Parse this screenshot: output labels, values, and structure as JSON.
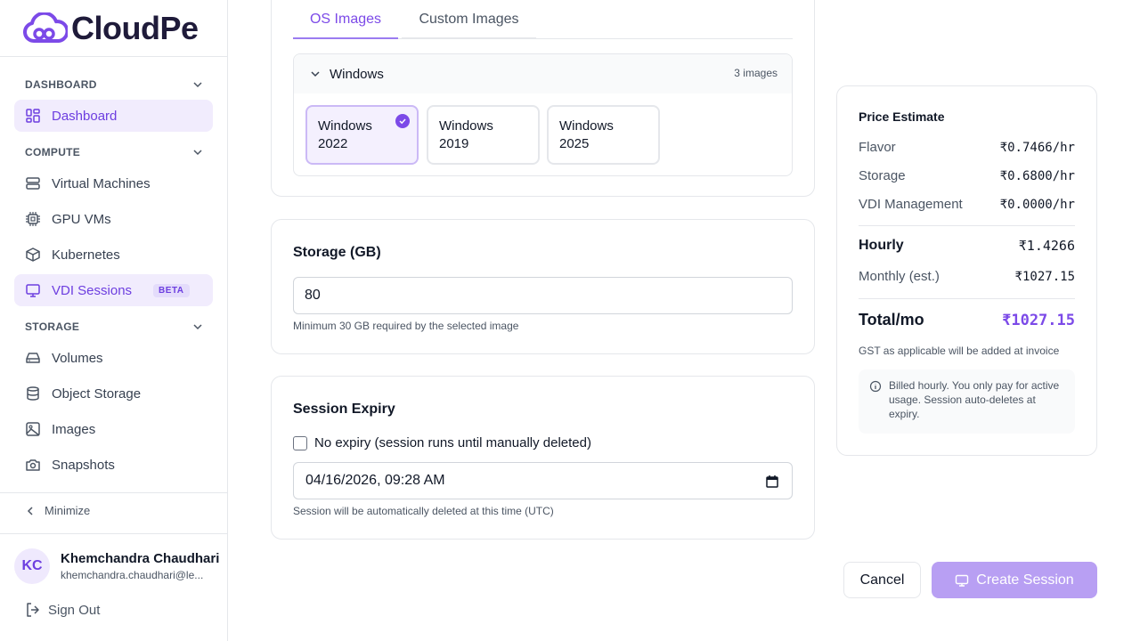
{
  "brand": {
    "name": "CloudPe",
    "accent": "#7c4ae8"
  },
  "sidebar": {
    "sections": [
      {
        "label": "DASHBOARD",
        "items": [
          {
            "label": "Dashboard",
            "icon": "dashboard-icon",
            "active": true
          }
        ]
      },
      {
        "label": "COMPUTE",
        "items": [
          {
            "label": "Virtual Machines",
            "icon": "server-icon"
          },
          {
            "label": "GPU VMs",
            "icon": "chip-icon"
          },
          {
            "label": "Kubernetes",
            "icon": "cube-icon"
          },
          {
            "label": "VDI Sessions",
            "icon": "monitor-icon",
            "active": true,
            "badge": "BETA"
          }
        ]
      },
      {
        "label": "STORAGE",
        "items": [
          {
            "label": "Volumes",
            "icon": "drive-icon"
          },
          {
            "label": "Object Storage",
            "icon": "database-icon"
          },
          {
            "label": "Images",
            "icon": "image-icon"
          },
          {
            "label": "Snapshots",
            "icon": "camera-icon"
          }
        ]
      }
    ],
    "minimize": "Minimize",
    "user": {
      "initials": "KC",
      "name": "Khemchandra Chaudhari",
      "email": "khemchandra.chaudhari@le..."
    },
    "sign_out": "Sign Out"
  },
  "image_picker": {
    "tabs": [
      {
        "label": "OS Images",
        "active": true
      },
      {
        "label": "Custom Images",
        "active": false
      }
    ],
    "group": {
      "name": "Windows",
      "count": "3 images"
    },
    "options": [
      {
        "line1": "Windows",
        "line2": "2022",
        "selected": true
      },
      {
        "line1": "Windows",
        "line2": "2019",
        "selected": false
      },
      {
        "line1": "Windows",
        "line2": "2025",
        "selected": false
      }
    ]
  },
  "storage": {
    "title": "Storage (GB)",
    "value": "80",
    "helper": "Minimum 30 GB required by the selected image"
  },
  "expiry": {
    "title": "Session Expiry",
    "no_expiry_label": "No expiry (session runs until manually deleted)",
    "no_expiry_checked": false,
    "datetime": "04/16/2026, 09:28 AM",
    "helper": "Session will be automatically deleted at this time (UTC)"
  },
  "price": {
    "title": "Price Estimate",
    "rows": [
      {
        "label": "Flavor",
        "value": "₹0.7466/hr"
      },
      {
        "label": "Storage",
        "value": "₹0.6800/hr"
      },
      {
        "label": "VDI Management",
        "value": "₹0.0000/hr"
      }
    ],
    "hourly_label": "Hourly",
    "hourly_value": "₹1.4266",
    "monthly_label": "Monthly (est.)",
    "monthly_value": "₹1027.15",
    "total_label": "Total/mo",
    "total_value": "₹1027.15",
    "gst": "GST as applicable will be added at invoice",
    "note": "Billed hourly. You only pay for active usage. Session auto-deletes at expiry."
  },
  "actions": {
    "cancel": "Cancel",
    "create": "Create Session"
  }
}
